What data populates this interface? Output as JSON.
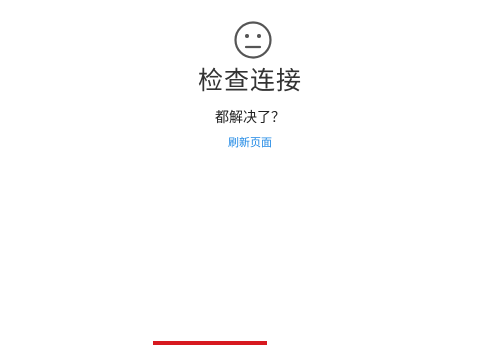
{
  "error_page": {
    "icon": "neutral-face-icon",
    "title": "检查连接",
    "subtitle": "都解决了？",
    "refresh_link": "刷新页面"
  },
  "colors": {
    "icon": "#555555",
    "title": "#333333",
    "link": "#1e88e5",
    "accent_bar": "#d71920"
  }
}
